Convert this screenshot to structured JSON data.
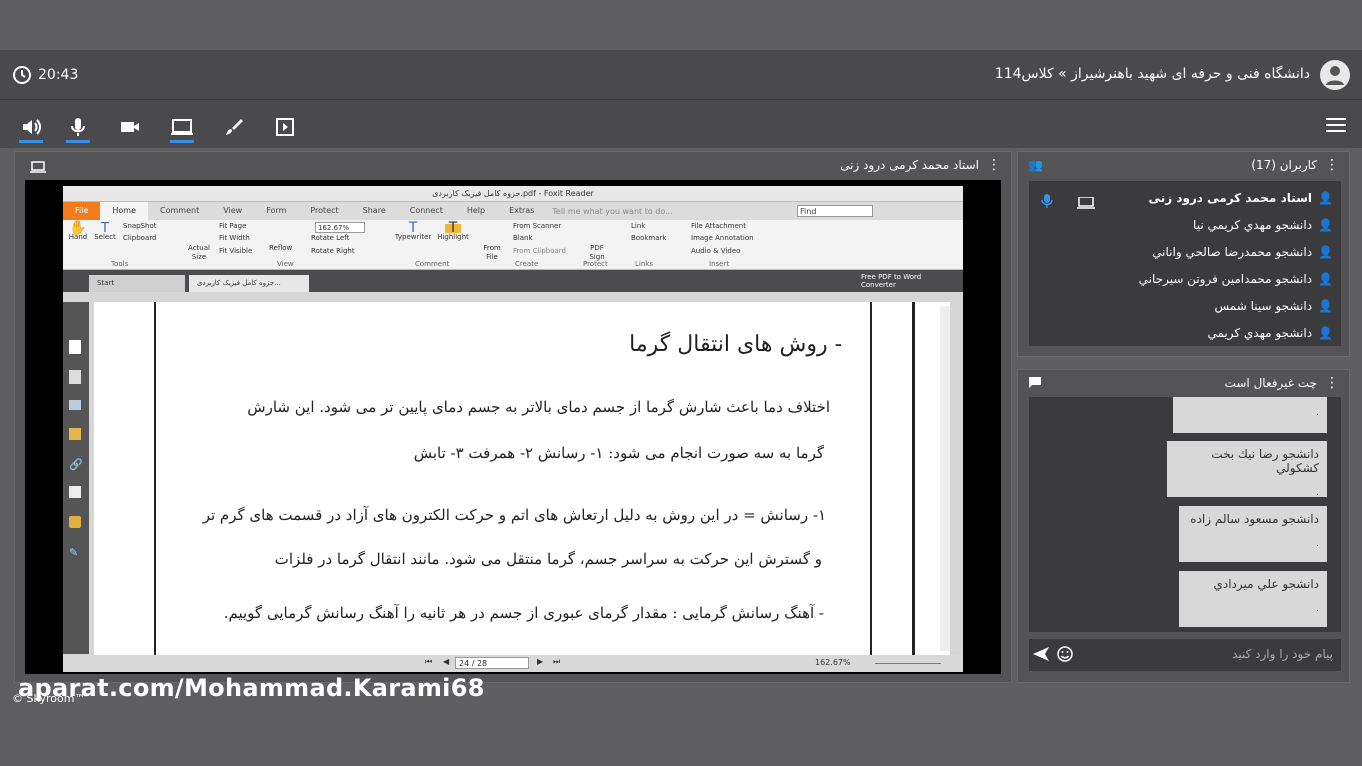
{
  "header": {
    "time": "20:43",
    "title": "دانشگاه فنی و حرفه ای شهید باهنرشیراز » کلاس114"
  },
  "main": {
    "presenter": "استاد محمد کرمی درود زنی"
  },
  "foxit": {
    "window_title": "جزوه کامل فیزیک کاربردی.pdf - Foxit Reader",
    "tabs": [
      "File",
      "Home",
      "Comment",
      "View",
      "Form",
      "Protect",
      "Share",
      "Connect",
      "Help",
      "Extras"
    ],
    "search_hint": "Tell me what you want to do...",
    "find_placeholder": "Find",
    "zoom": "162.67%",
    "ribbon": {
      "hand": "Hand",
      "select": "Select",
      "snapshot": "SnapShot",
      "clipboard": "Clipboard",
      "tools_group": "Tools",
      "actual_size": "Actual Size",
      "fit_page": "Fit Page",
      "fit_width": "Fit Width",
      "fit_visible": "Fit Visible",
      "reflow": "Reflow",
      "rotate_left": "Rotate Left",
      "rotate_right": "Rotate Right",
      "view_group": "View",
      "typewriter": "Typewriter",
      "highlight": "Highlight",
      "comment_group": "Comment",
      "from_file": "From File",
      "from_scanner": "From Scanner",
      "blank": "Blank",
      "from_clipboard": "From Clipboard",
      "create_group": "Create",
      "pdf_sign": "PDF Sign",
      "protect_group": "Protect",
      "link": "Link",
      "bookmark": "Bookmark",
      "links_group": "Links",
      "file_attachment": "File Attachment",
      "image_annotation": "Image Annotation",
      "audio_video": "Audio & Video",
      "insert_group": "Insert"
    },
    "doc_tabs": [
      "Start",
      "جزوه کامل فیزیک کاربردی..."
    ],
    "converter": "Free PDF to Word Converter",
    "page_indicator": "24 / 28",
    "zoom_status": "162.67%"
  },
  "page_text": {
    "heading": "- روش های انتقال گرما",
    "line1": "اختلاف دما باعث شارش گرما از جسم دمای بالاتر به جسم دمای پایین تر می شود. این شارش",
    "line2": "گرما به سه صورت انجام می شود:    ۱- رسانش      ۲- همرفت      ۳- تابش",
    "line3": "۱- رسانش = در این روش به دلیل ارتعاش های اتم و حرکت الکترون های آزاد در قسمت های گرم تر",
    "line4": "و گسترش این حرکت به سراسر جسم، گرما منتقل می شود. مانند انتقال گرما در فلزات",
    "line5": "- آهنگ رسانش گرمایی :  مقدار گرمای عبوری از جسم در هر ثانیه را آهنگ رسانش گرمایی گوییم."
  },
  "watermark": "aparat.com/Mohammad.Karami68",
  "brand": "© Skyroom™",
  "users": {
    "title": "کاربران (17)",
    "list": [
      "استاد محمد کرمی درود زنی",
      "دانشجو مهدي كريمي نيا",
      "دانشجو محمدرضا صالحي واناني",
      "دانشجو محمدامين فروتن سيرجاني",
      "دانشجو سينا شمس",
      "دانشجو مهدي كريمي"
    ]
  },
  "chat": {
    "title": "چت غیرفعال است",
    "messages": [
      {
        "name": "",
        "body": "."
      },
      {
        "name": "دانشجو رضا نيك بخت كشكولي",
        "body": "."
      },
      {
        "name": "دانشجو مسعود سالم زاده",
        "body": "."
      },
      {
        "name": "دانشجو علي ميردادي",
        "body": "."
      }
    ],
    "placeholder": "پیام خود را وارد کنید"
  }
}
